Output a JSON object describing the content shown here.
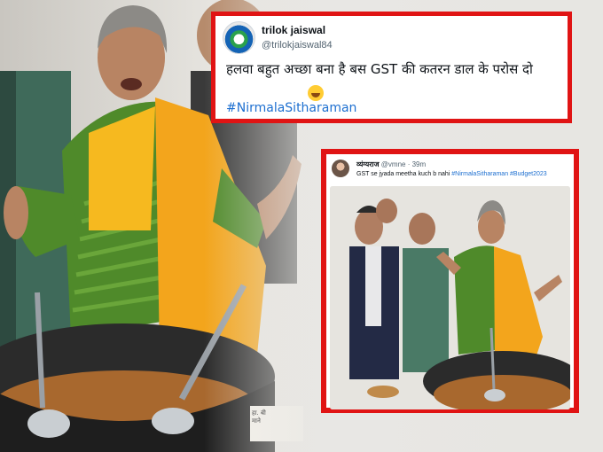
{
  "tweet_main": {
    "name": "trilok jaiswal",
    "handle": "@trilokjaiswal84",
    "text": "हलवा बहुत अच्छा बना है बस GST की कतरन डाल के परोस दो",
    "emoji": "smile-emoji",
    "hashtag": "#NirmalaSitharaman"
  },
  "tweet_inner": {
    "name": "व्यंग्यराज",
    "handle": "@vmne",
    "time": "39m",
    "text": "GST se jyada meetha kuch b nahi",
    "hashtags": "#NirmalaSitharaman #Budget2023"
  },
  "photo": {
    "sign_text": "हा. बी\nमाने"
  },
  "colors": {
    "frame_red": "#e01414",
    "hashtag_blue": "#1d6fd0",
    "saree_green": "#4f8a2a",
    "saree_yellow": "#f3a51c"
  }
}
